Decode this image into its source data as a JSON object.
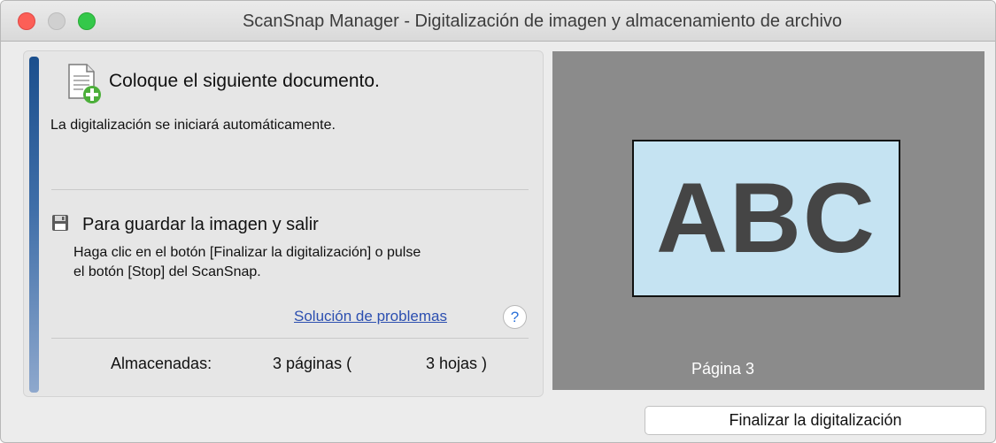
{
  "window": {
    "title": "ScanSnap Manager - Digitalización de imagen y almacenamiento de archivo"
  },
  "left_panel": {
    "doc_icon": "document-add-icon",
    "heading": "Coloque el siguiente documento.",
    "auto_text": "La digitalización se iniciará automáticamente.",
    "save_icon": "floppy-disk-icon",
    "save_heading": "Para guardar la imagen y salir",
    "instruction_lines": [
      "Haga clic en el botón [Finalizar la digitalización] o pulse",
      "el botón [Stop] del ScanSnap."
    ],
    "help_link": "Solución de problemas",
    "help_button": "?",
    "stats": {
      "label": "Almacenadas:",
      "pages": "3 páginas (",
      "sheets": "3 hojas )"
    }
  },
  "preview": {
    "page_text": "ABC",
    "page_label": "Página 3"
  },
  "actions": {
    "finish_button": "Finalizar la digitalización"
  },
  "colors": {
    "accent_bar": "#1b4f8d",
    "link": "#2c4fb0",
    "preview_bg": "#8b8b8b",
    "page_bg": "#c5e3f2",
    "traffic_close": "#fc5f57",
    "traffic_max": "#34c84a"
  }
}
